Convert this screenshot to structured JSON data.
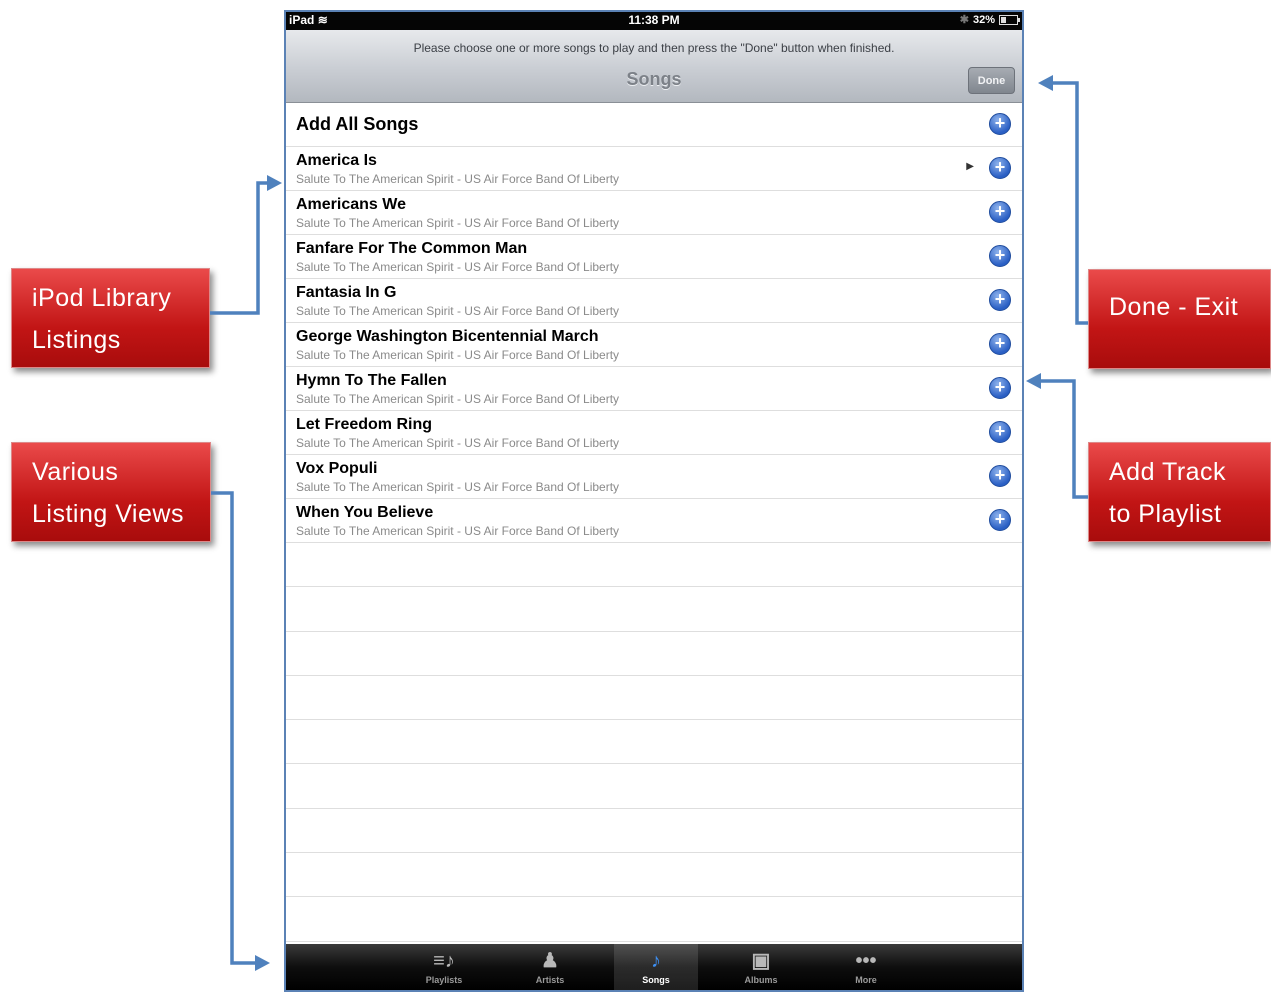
{
  "statusbar": {
    "device": "iPad",
    "time": "11:38 PM",
    "bluetooth": "✱",
    "battery_label": "32%",
    "battery_level": 0.32
  },
  "navbar": {
    "prompt": "Please choose one or more songs to play and then press the \"Done\" button when finished.",
    "title": "Songs",
    "done_label": "Done"
  },
  "add_all_label": "Add All Songs",
  "songs": [
    {
      "title": "America Is",
      "subtitle": "Salute To The American Spirit - US Air Force Band Of Liberty",
      "now_playing": true
    },
    {
      "title": "Americans We",
      "subtitle": "Salute To The American Spirit - US Air Force Band Of Liberty"
    },
    {
      "title": "Fanfare For The Common Man",
      "subtitle": "Salute To The American Spirit - US Air Force Band Of Liberty"
    },
    {
      "title": "Fantasia In G",
      "subtitle": "Salute To The American Spirit - US Air Force Band Of Liberty"
    },
    {
      "title": "George Washington Bicentennial March",
      "subtitle": "Salute To The American Spirit - US Air Force Band Of Liberty"
    },
    {
      "title": "Hymn To The Fallen",
      "subtitle": "Salute To The American Spirit - US Air Force Band Of Liberty"
    },
    {
      "title": "Let Freedom Ring",
      "subtitle": "Salute To The American Spirit - US Air Force Band Of Liberty"
    },
    {
      "title": "Vox Populi",
      "subtitle": "Salute To The American Spirit - US Air Force Band Of Liberty"
    },
    {
      "title": "When You Believe",
      "subtitle": "Salute To The American Spirit - US Air Force Band Of Liberty"
    }
  ],
  "tabs": [
    {
      "label": "Playlists",
      "icon": "playlists-icon"
    },
    {
      "label": "Artists",
      "icon": "artists-icon"
    },
    {
      "label": "Songs",
      "icon": "songs-icon",
      "selected": true
    },
    {
      "label": "Albums",
      "icon": "albums-icon"
    },
    {
      "label": "More",
      "icon": "more-icon"
    }
  ],
  "callouts": {
    "library": "iPod Library Listings",
    "views": "Various Listing Views",
    "done": "Done - Exit",
    "add_track": "Add Track to Playlist"
  },
  "colors": {
    "callout_red": "#c21515",
    "arrow_blue": "#4f81bd",
    "add_blue": "#2a5fc4"
  }
}
